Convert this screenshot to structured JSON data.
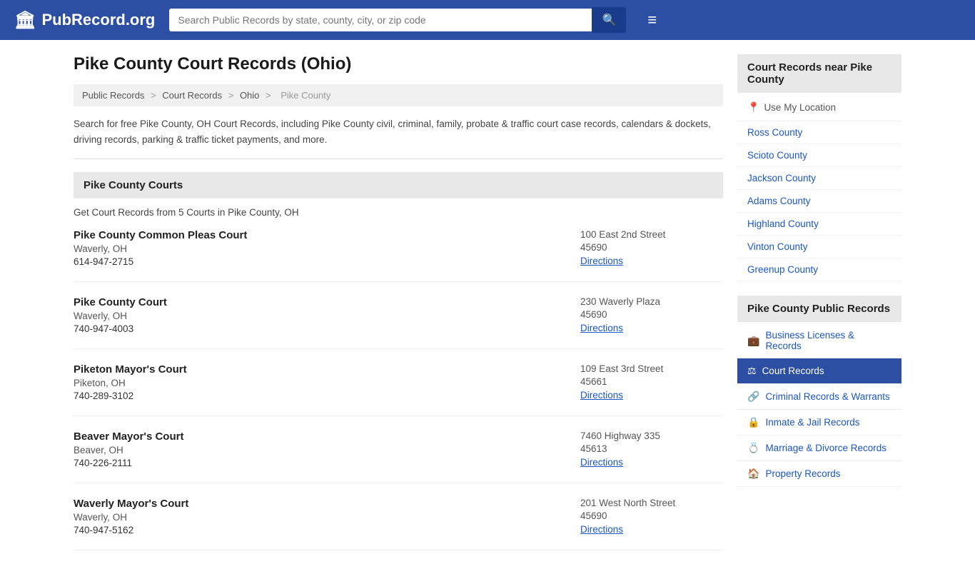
{
  "header": {
    "logo_text": "PubRecord.org",
    "logo_icon": "🏛",
    "search_placeholder": "Search Public Records by state, county, city, or zip code",
    "search_icon": "🔍",
    "menu_icon": "≡"
  },
  "page": {
    "title": "Pike County Court Records (Ohio)",
    "description": "Search for free Pike County, OH Court Records, including Pike County civil, criminal, family, probate & traffic court case records, calendars & dockets, driving records, parking & traffic ticket payments, and more."
  },
  "breadcrumb": {
    "items": [
      "Public Records",
      "Court Records",
      "Ohio",
      "Pike County"
    ]
  },
  "courts_section": {
    "header": "Pike County Courts",
    "subtitle": "Get Court Records from 5 Courts in Pike County, OH",
    "courts": [
      {
        "name": "Pike County Common Pleas Court",
        "city": "Waverly, OH",
        "phone": "614-947-2715",
        "street": "100 East 2nd Street",
        "zip": "45690",
        "directions_label": "Directions"
      },
      {
        "name": "Pike County Court",
        "city": "Waverly, OH",
        "phone": "740-947-4003",
        "street": "230 Waverly Plaza",
        "zip": "45690",
        "directions_label": "Directions"
      },
      {
        "name": "Piketon Mayor's Court",
        "city": "Piketon, OH",
        "phone": "740-289-3102",
        "street": "109 East 3rd Street",
        "zip": "45661",
        "directions_label": "Directions"
      },
      {
        "name": "Beaver Mayor's Court",
        "city": "Beaver, OH",
        "phone": "740-226-2111",
        "street": "7460 Highway 335",
        "zip": "45613",
        "directions_label": "Directions"
      },
      {
        "name": "Waverly Mayor's Court",
        "city": "Waverly, OH",
        "phone": "740-947-5162",
        "street": "201 West North Street",
        "zip": "45690",
        "directions_label": "Directions"
      }
    ]
  },
  "sidebar": {
    "nearby_title": "Court Records near Pike County",
    "use_location_label": "Use My Location",
    "nearby_counties": [
      "Ross County",
      "Scioto County",
      "Jackson County",
      "Adams County",
      "Highland County",
      "Vinton County",
      "Greenup County"
    ],
    "public_records_title": "Pike County Public Records",
    "records_links": [
      {
        "label": "Business Licenses & Records",
        "icon": "💼",
        "active": false
      },
      {
        "label": "Court Records",
        "icon": "⚖",
        "active": true
      },
      {
        "label": "Criminal Records & Warrants",
        "icon": "🔗",
        "active": false
      },
      {
        "label": "Inmate & Jail Records",
        "icon": "🔒",
        "active": false
      },
      {
        "label": "Marriage & Divorce Records",
        "icon": "💍",
        "active": false
      },
      {
        "label": "Property Records",
        "icon": "🏠",
        "active": false
      }
    ]
  }
}
